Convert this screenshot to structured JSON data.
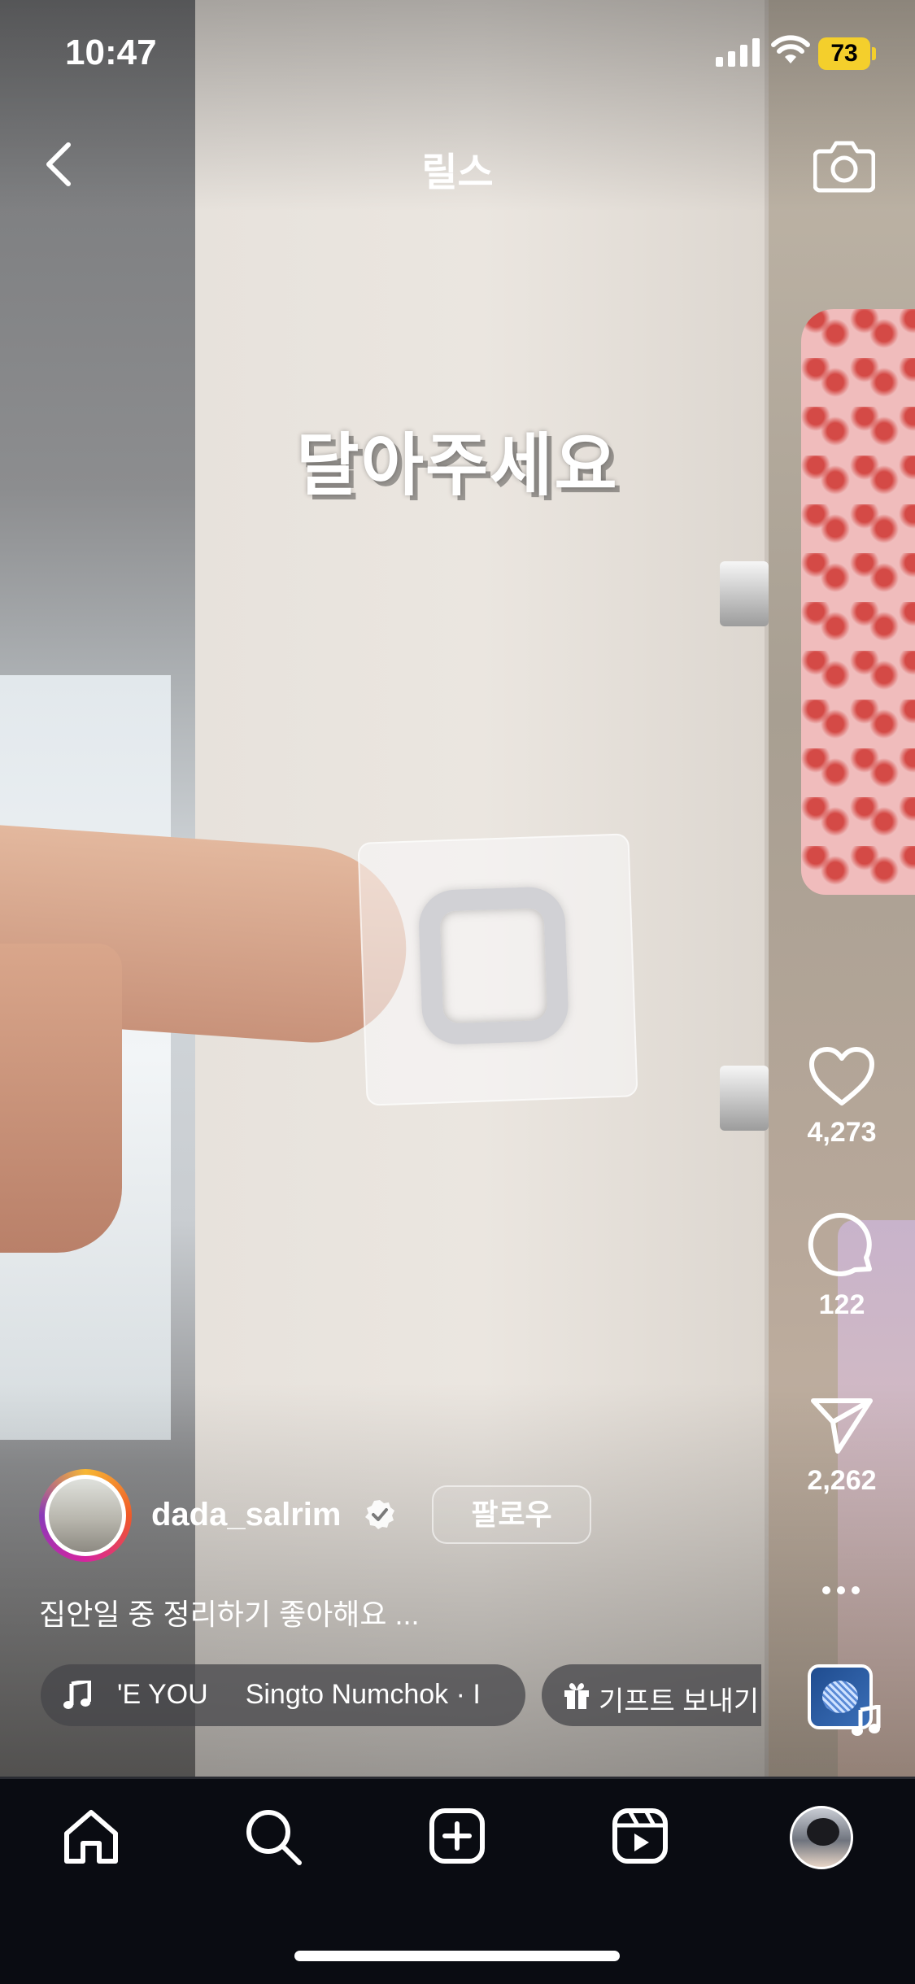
{
  "status_bar": {
    "time": "10:47",
    "battery": "73"
  },
  "header": {
    "title": "릴스"
  },
  "video": {
    "overlay_text": "달아주세요"
  },
  "actions": {
    "likes": "4,273",
    "comments": "122",
    "shares": "2,262"
  },
  "post": {
    "username": "dada_salrim",
    "follow_label": "팔로우",
    "caption": "집안일 중 정리하기 좋아해요 ...",
    "music_items": [
      "'E YOU",
      "Singto Numchok · I"
    ],
    "gift_label": "기프트 보내기"
  },
  "icons": {
    "back": "chevron-left-icon",
    "camera": "camera-icon",
    "like": "heart-icon",
    "comment": "comment-icon",
    "share": "paper-plane-icon",
    "more": "ellipsis-icon",
    "music": "music-note-icon",
    "gift": "gift-icon",
    "home": "home-icon",
    "search": "search-icon",
    "create": "plus-square-icon",
    "reels": "reels-icon"
  },
  "colors": {
    "battery": "#f4cf2c",
    "nav_bg": "#0a0c12"
  }
}
